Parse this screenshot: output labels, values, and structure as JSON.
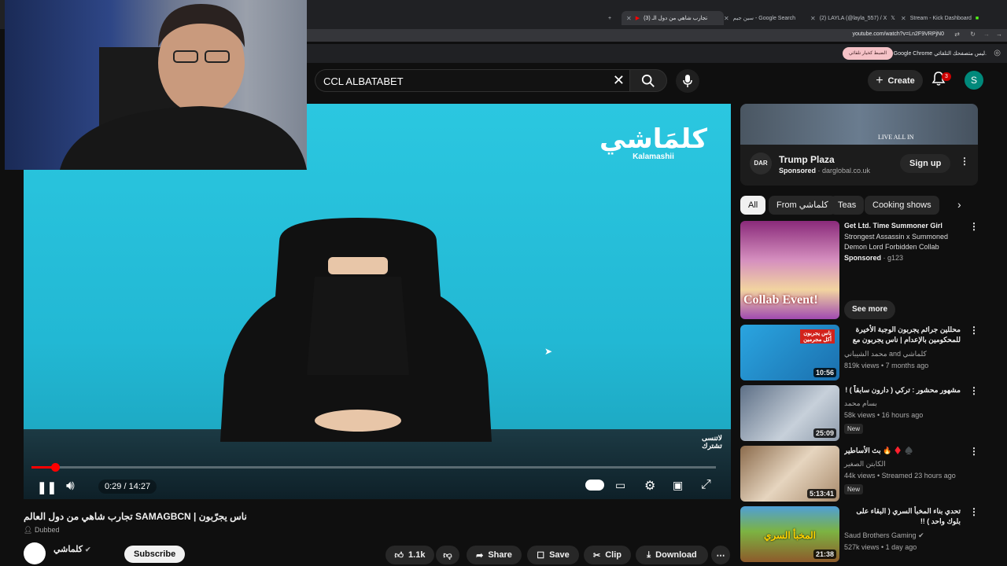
{
  "browser": {
    "tabs": [
      {
        "label": "(3) تجارب شاهي من دول الـ",
        "active": true
      },
      {
        "label": "سين جيم - Google Search",
        "active": false
      },
      {
        "label": "(2) LAYLA (@layla_557) / X",
        "active": false
      },
      {
        "label": "Stream - Kick Dashboard",
        "active": false
      }
    ],
    "url": "youtube.com/watch?v=Ln2F9VRPjN0",
    "infobar_text": "Google Chrome ليس متصفحك التلقائي.",
    "infobar_button": "الضبط كخيار تلقائي"
  },
  "header": {
    "search_value": "CCL ALBATABET",
    "create_label": "Create",
    "notification_count": "3",
    "avatar_letter": "S"
  },
  "video": {
    "brand_logo_ar": "كلمَاشي",
    "brand_logo_en": "Kalamashii",
    "watermark": "لاتنسى تشترك",
    "current_time": "0:29 / 14:27",
    "progress_fraction": 0.034
  },
  "details": {
    "title": "ناس يجرّبون | SAMAGBCN تجارب شاهي من دول العالم",
    "dubbed_label": "Dubbed",
    "channel_name": "كلماشي",
    "subscribe_label": "Subscribe",
    "likes": "1.1k",
    "share_label": "Share",
    "save_label": "Save",
    "clip_label": "Clip",
    "download_label": "Download"
  },
  "sidebar": {
    "ad": {
      "banner_text": "LIVE ALL IN",
      "logo": "DAR",
      "title": "Trump Plaza",
      "sponsored": "Sponsored",
      "domain": "darglobal.co.uk",
      "cta": "Sign up"
    },
    "chips": [
      "All",
      "From كلماشي",
      "Teas",
      "Cooking shows"
    ],
    "recommendations": [
      {
        "title": "Get Ltd. Time Summoner Girl",
        "line2": "Strongest Assassin x Summoned Demon Lord Forbidden Collab",
        "meta": "g123",
        "sponsored": "Sponsored",
        "cta": "See more",
        "thumb_text": "Collab Event!"
      },
      {
        "title": "محللين جرائم يجربون الوجبة الأخيرة للمحكومين بالإعدام | ناس يجربون مع مدير...",
        "channel": "محمد الشيباني and كلماشي",
        "meta": "819k views • 7 months ago",
        "duration": "10:56",
        "thumb_text": "ناس يجربون أكل مجرمين"
      },
      {
        "title": "مشهور محشور : تركي ( دارون سابقاً ) !",
        "channel": "بسام محمد",
        "meta": "58k views • 16 hours ago",
        "badge": "New",
        "duration": "25:09"
      },
      {
        "title": "بث الأساطير 🔥 ♦️ ♠️",
        "channel": "الكابتن الصغير",
        "meta": "44k views • Streamed 23 hours ago",
        "badge": "New",
        "duration": "5:13:41"
      },
      {
        "title": "تحدي بناء المخبأ السري ( البقاء على بلوك واحد ) !!",
        "channel": "Saud Brothers Gaming",
        "meta": "527k views • 1 day ago",
        "duration": "21:38",
        "thumb_text": "المخبأ السري"
      }
    ]
  },
  "colors": {
    "accent": "#ff0000",
    "background": "#0f0f0f",
    "video_bg": "#2bc7e0"
  }
}
